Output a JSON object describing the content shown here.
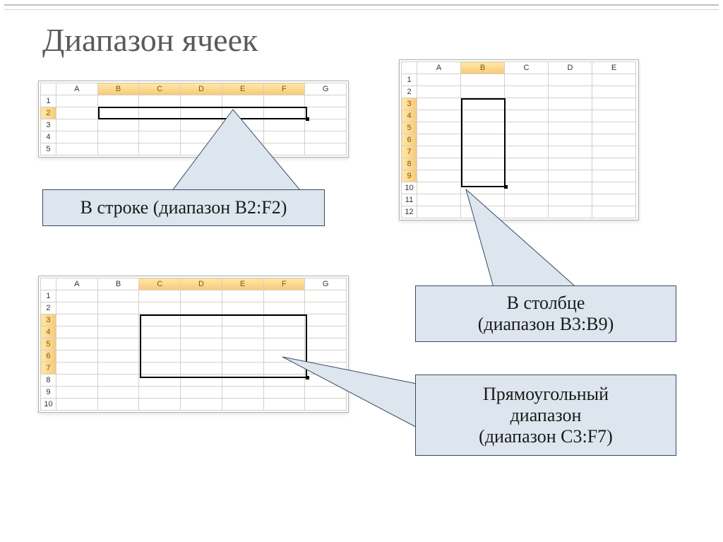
{
  "title": "Диапазон ячеек",
  "sheet1": {
    "cols": [
      "A",
      "B",
      "C",
      "D",
      "E",
      "F",
      "G"
    ],
    "rows": [
      "1",
      "2",
      "3",
      "4",
      "5"
    ],
    "selection": "B2:F2"
  },
  "sheet2": {
    "cols": [
      "A",
      "B",
      "C",
      "D",
      "E"
    ],
    "rows": [
      "1",
      "2",
      "3",
      "4",
      "5",
      "6",
      "7",
      "8",
      "9",
      "10",
      "11",
      "12"
    ],
    "selection": "B3:B9"
  },
  "sheet3": {
    "cols": [
      "A",
      "B",
      "C",
      "D",
      "E",
      "F",
      "G"
    ],
    "rows": [
      "1",
      "2",
      "3",
      "4",
      "5",
      "6",
      "7",
      "8",
      "9",
      "10"
    ],
    "selection": "C3:F7"
  },
  "callout_row": "В строке (диапазон  B2:F2)",
  "callout_col_l1": "В столбце",
  "callout_col_l2": "(диапазон  B3:B9)",
  "callout_rect_l1": "Прямоугольный",
  "callout_rect_l2": "диапазон",
  "callout_rect_l3": "(диапазон  C3:F7)"
}
